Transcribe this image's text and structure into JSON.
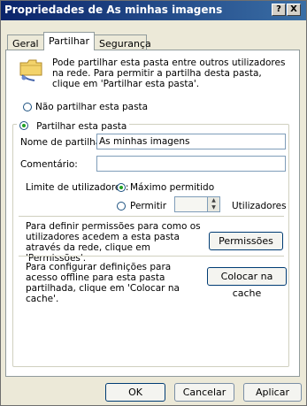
{
  "window": {
    "title": "Propriedades de As minhas imagens",
    "help_button": "?",
    "close_button": "X"
  },
  "tabs": [
    {
      "label": "Geral"
    },
    {
      "label": "Partilhar"
    },
    {
      "label": "Segurança"
    }
  ],
  "sharing": {
    "info_text": "Pode partilhar esta pasta entre outros utilizadores na rede. Para permitir a partilha desta pasta, clique em 'Partilhar esta pasta'.",
    "radio_not_share": "Não partilhar esta pasta",
    "radio_share": "Partilhar esta pasta",
    "share_name_label": "Nome de partilha:",
    "share_name_value": "As minhas imagens",
    "comment_label": "Comentário:",
    "comment_value": "",
    "user_limit_label": "Limite de utilizadores:",
    "max_allowed": "Máximo permitido",
    "allow": "Permitir",
    "allow_value": "",
    "users_unit": "Utilizadores",
    "permissions_text": "Para definir permissões para como os utilizadores acedem a esta pasta através da rede, clique em 'Permissões'.",
    "permissions_button": "Permissões",
    "offline_text": "Para configurar definições para acesso offline para esta pasta partilhada, clique em 'Colocar na cache'.",
    "cache_button": "Colocar na cache"
  },
  "footer": {
    "ok": "OK",
    "cancel": "Cancelar",
    "apply": "Aplicar"
  }
}
